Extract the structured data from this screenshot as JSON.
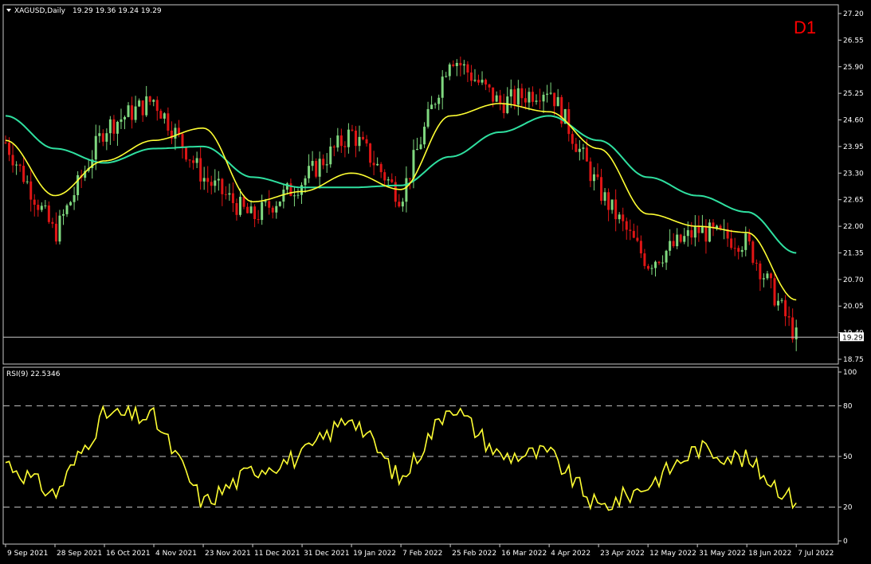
{
  "header": {
    "symbol": "XAGUSD,Daily",
    "ohlc": "19.29 19.36 19.24 19.29",
    "timeframe": "D1"
  },
  "colors": {
    "background": "#000000",
    "bull_candle": "#7fd87f",
    "bear_candle": "#e01515",
    "ma_fast": "#ffff33",
    "ma_slow": "#2fe0a0",
    "rsi_line": "#ffff33",
    "grid_dash": "#c8c8c8",
    "price_line": "#c8c8c8",
    "timeframe_label": "#ff0000"
  },
  "chart_data": [
    {
      "type": "line",
      "title": "XAGUSD,Daily",
      "current_price": 19.29,
      "current_price_label": "19.29",
      "ylim": [
        18.75,
        27.2
      ],
      "y_ticks": [
        "27.20",
        "26.55",
        "25.90",
        "25.25",
        "24.60",
        "23.95",
        "23.30",
        "22.65",
        "22.00",
        "21.35",
        "20.70",
        "20.05",
        "19.40",
        "18.75"
      ],
      "x_tick_labels": [
        "9 Sep 2021",
        "28 Sep 2021",
        "16 Oct 2021",
        "4 Nov 2021",
        "23 Nov 2021",
        "11 Dec 2021",
        "31 Dec 2021",
        "19 Jan 2022",
        "7 Feb 2022",
        "25 Feb 2022",
        "16 Mar 2022",
        "4 Apr 2022",
        "23 Apr 2022",
        "12 May 2022",
        "31 May 2022",
        "18 Jun 2022",
        "7 Jul 2022"
      ],
      "series": [
        {
          "role": "price",
          "x": [
            "9 Sep 2021",
            "28 Sep 2021",
            "16 Oct 2021",
            "4 Nov 2021",
            "23 Nov 2021",
            "11 Dec 2021",
            "31 Dec 2021",
            "19 Jan 2022",
            "7 Feb 2022",
            "25 Feb 2022",
            "16 Mar 2022",
            "4 Apr 2022",
            "23 Apr 2022",
            "12 May 2022",
            "31 May 2022",
            "18 Jun 2022",
            "7 Jul 2022"
          ],
          "values": [
            24.05,
            21.8,
            24.4,
            25.1,
            23.2,
            22.2,
            23.1,
            24.3,
            22.7,
            26.2,
            25.0,
            25.4,
            22.9,
            21.1,
            21.9,
            21.6,
            19.29
          ]
        },
        {
          "role": "ma_fast",
          "values": [
            24.1,
            22.75,
            23.6,
            24.1,
            24.4,
            22.6,
            22.85,
            23.3,
            22.9,
            24.7,
            25.0,
            24.8,
            23.9,
            22.3,
            22.0,
            21.85,
            20.2
          ]
        },
        {
          "role": "ma_slow",
          "values": [
            24.7,
            23.9,
            23.55,
            23.9,
            23.95,
            23.2,
            22.95,
            22.95,
            23.0,
            23.7,
            24.3,
            24.7,
            24.1,
            23.2,
            22.75,
            22.35,
            21.35
          ]
        }
      ]
    },
    {
      "type": "line",
      "title": "RSI(9) 22.5346",
      "ylim": [
        0,
        100
      ],
      "y_ticks": [
        "100",
        "80",
        "50",
        "20",
        "0"
      ],
      "levels": [
        80,
        50,
        20
      ],
      "x": [
        "9 Sep 2021",
        "28 Sep 2021",
        "16 Oct 2021",
        "4 Nov 2021",
        "23 Nov 2021",
        "11 Dec 2021",
        "31 Dec 2021",
        "19 Jan 2022",
        "7 Feb 2022",
        "25 Feb 2022",
        "16 Mar 2022",
        "4 Apr 2022",
        "23 Apr 2022",
        "12 May 2022",
        "31 May 2022",
        "18 Jun 2022",
        "7 Jul 2022"
      ],
      "series": [
        {
          "name": "RSI(9)",
          "values": [
            47,
            27,
            75,
            73,
            22,
            42,
            50,
            75,
            35,
            82,
            50,
            52,
            19,
            33,
            55,
            48,
            22.5
          ]
        }
      ]
    }
  ]
}
